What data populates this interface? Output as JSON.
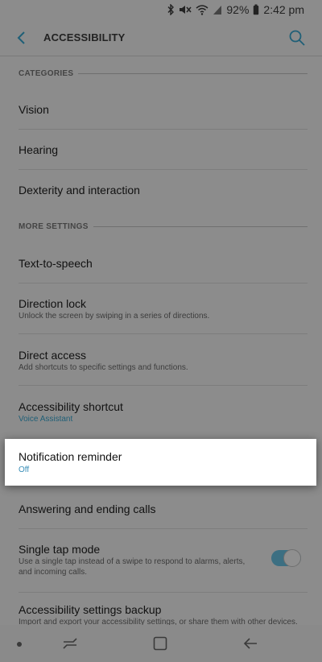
{
  "status_bar": {
    "battery": "92%",
    "time": "2:42 pm"
  },
  "header": {
    "title": "ACCESSIBILITY"
  },
  "sections": {
    "categories": "CATEGORIES",
    "more_settings": "MORE SETTINGS"
  },
  "items": {
    "vision": "Vision",
    "hearing": "Hearing",
    "dexterity": "Dexterity and interaction",
    "tts": "Text-to-speech",
    "direction_lock": {
      "title": "Direction lock",
      "subtitle": "Unlock the screen by swiping in a series of directions."
    },
    "direct_access": {
      "title": "Direct access",
      "subtitle": "Add shortcuts to specific settings and functions."
    },
    "accessibility_shortcut": {
      "title": "Accessibility shortcut",
      "subtitle": "Voice Assistant"
    },
    "notification_reminder": {
      "title": "Notification reminder",
      "subtitle": "Off"
    },
    "answering_calls": "Answering and ending calls",
    "single_tap": {
      "title": "Single tap mode",
      "subtitle_line1": "Use a single tap instead of a swipe to respond to alarms, alerts,",
      "subtitle_line2": "and incoming calls.",
      "enabled": true
    },
    "backup": {
      "title": "Accessibility settings backup",
      "subtitle": "Import and export your accessibility settings, or share them with other devices."
    }
  },
  "colors": {
    "dim_background": "#8c8c8c",
    "highlight_card": "#ffffff",
    "accent_blue": "#3a8fb8",
    "toggle_track": "#3c6f82"
  }
}
